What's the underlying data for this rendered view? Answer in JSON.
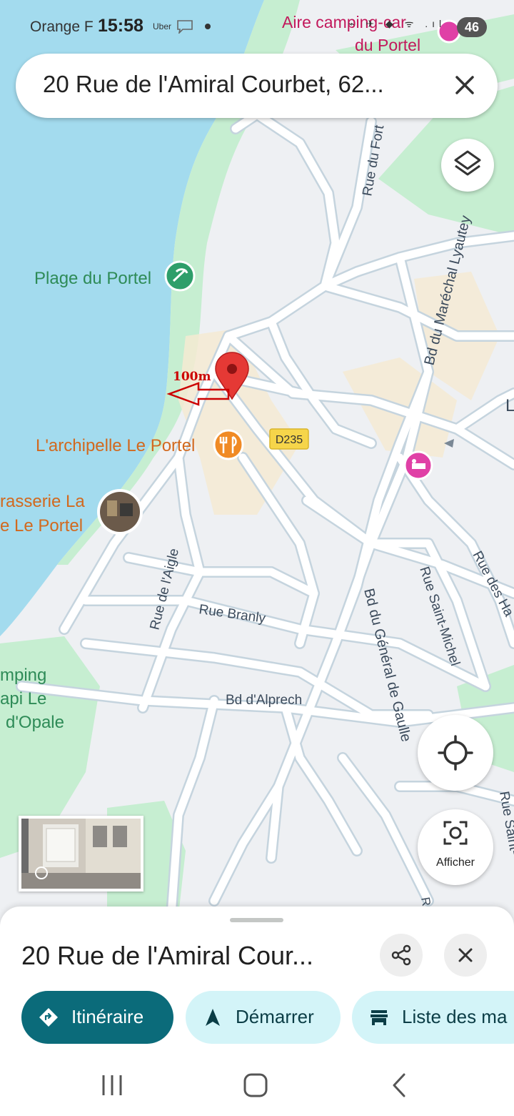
{
  "status_bar": {
    "carrier": "Orange F",
    "time": "15:58",
    "uber_notification": "Uber",
    "signal_icons": "⌁ ✈ ◆ ᯤ .ıl",
    "battery": "46"
  },
  "search": {
    "query": "20 Rue de l'Amiral Courbet, 62...",
    "clear_icon": "close-icon"
  },
  "map": {
    "pois": {
      "aire_camping_line1": "Aire camping-car",
      "aire_camping_line2": "du Portel",
      "plage": "Plage du Portel",
      "archipelle": "L'archipelle Le Portel",
      "brasserie_line1": "rasserie La",
      "brasserie_line2": "e Le Portel",
      "camping_line1": "mping",
      "camping_line2": "api Le",
      "camping_line3": "d'Opale"
    },
    "streets": {
      "rue_du_fort": "Rue du Fort",
      "bd_marechal": "Bd du Maréchal Lyautey",
      "rue_aigle": "Rue de l'Aigle",
      "rue_branly": "Rue Branly",
      "bd_alprech": "Bd d'Alprech",
      "bd_general": "Bd du Général de Gaulle",
      "rue_st_michel": "Rue Saint-Michel",
      "rue_des_ha": "Rue des Ha",
      "rue_saint_edge": "Rue Saint-",
      "edge_l": "L",
      "edge_r": "R"
    },
    "road_badge": "D235",
    "annotation": "100m",
    "colors": {
      "sea": "#a3dbee",
      "land": "#eef0f3",
      "park": "#c6eed1",
      "road": "#ffffff",
      "road_outline": "#c5d4de",
      "pin": "#e53935",
      "annotation": "#cc0000",
      "poi_green_text": "#2e8b57",
      "poi_orange_text": "#d2691e",
      "poi_pink_text": "#c2185b"
    }
  },
  "controls": {
    "layers_icon": "layers-icon",
    "locate_icon": "my-location-icon",
    "afficher_label": "Afficher",
    "afficher_icon": "lens-camera-icon"
  },
  "place_sheet": {
    "title": "20 Rue de l'Amiral Cour...",
    "share_icon": "share-icon",
    "close_icon": "close-icon",
    "actions": [
      {
        "label": "Itinéraire",
        "icon": "directions-icon"
      },
      {
        "label": "Démarrer",
        "icon": "navigation-arrow-icon"
      },
      {
        "label": "Liste des ma",
        "icon": "store-icon"
      }
    ]
  },
  "nav_bar": {
    "recents_icon": "recents-icon",
    "home_icon": "home-icon",
    "back_icon": "back-icon"
  }
}
